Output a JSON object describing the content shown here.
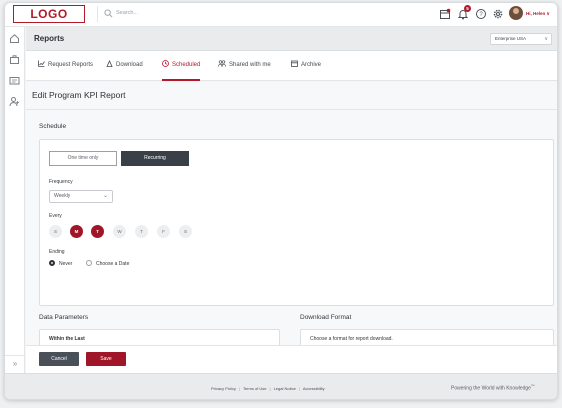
{
  "header": {
    "logo_text": "LOGO",
    "search_placeholder": "Search...",
    "notification_count": "5",
    "user_name": "Hi, Helen",
    "user_chevron": "∨"
  },
  "page": {
    "title": "Reports",
    "enterprise_select": "Enterprise USA",
    "select_chevron": "∨"
  },
  "tabs": [
    {
      "label": "Request Reports",
      "icon": "chart-icon"
    },
    {
      "label": "Download",
      "icon": "download-icon"
    },
    {
      "label": "Scheduled",
      "icon": "clock-icon",
      "active": true
    },
    {
      "label": "Shared with me",
      "icon": "people-icon"
    },
    {
      "label": "Archive",
      "icon": "archive-icon"
    }
  ],
  "form": {
    "title": "Edit Program KPI Report",
    "schedule_label": "Schedule",
    "one_time_label": "One time only",
    "recurring_label": "Recurring",
    "frequency_label": "Frequency",
    "frequency_value": "Weekly",
    "every_label": "Every",
    "days": [
      {
        "letter": "S",
        "selected": false
      },
      {
        "letter": "M",
        "selected": true
      },
      {
        "letter": "T",
        "selected": true
      },
      {
        "letter": "W",
        "selected": false
      },
      {
        "letter": "T",
        "selected": false
      },
      {
        "letter": "F",
        "selected": false
      },
      {
        "letter": "S",
        "selected": false
      }
    ],
    "ending_label": "Ending",
    "ending_never": "Never",
    "ending_date": "Choose a Date",
    "data_params_label": "Data Parameters",
    "within_last": "Within the Last",
    "download_format_label": "Download Format",
    "download_format_hint": "Choose a format for report download."
  },
  "actions": {
    "cancel": "Cancel",
    "save": "Save"
  },
  "footer": {
    "links": [
      "Privacy Policy",
      "Terms of Use",
      "Legal Notice",
      "Accessibility"
    ],
    "tagline": "Powering the World with Knowledge",
    "tagline_mark": "™"
  },
  "colors": {
    "brand": "#b2192b",
    "selected_day": "#a01628",
    "recurring_button": "#3a4047"
  }
}
